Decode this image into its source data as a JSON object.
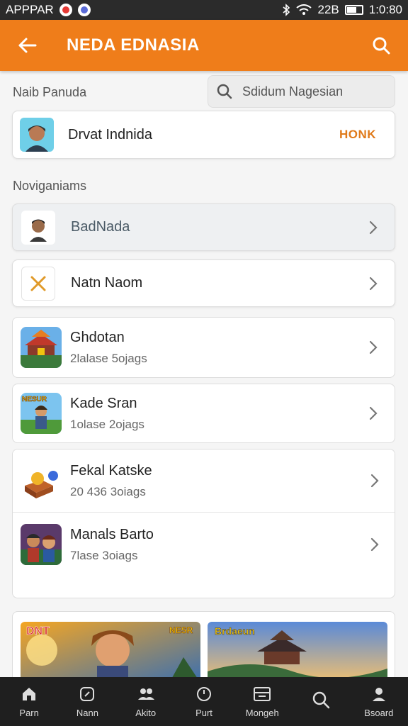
{
  "status_bar": {
    "left_text": "APPPAR",
    "right_text": "22B",
    "time": "1:0:80"
  },
  "app_bar": {
    "title": "NEDA EDNASIA"
  },
  "profile_section": {
    "label": "Naib Panuda"
  },
  "search": {
    "placeholder": "Sdidum Nagesian"
  },
  "profile_card": {
    "name": "Drvat Indnida",
    "action": "HONK"
  },
  "nav_section": {
    "label": "Noviganiams"
  },
  "nav_items": [
    {
      "label": "BadNada",
      "icon": "avatar-icon"
    },
    {
      "label": "Natn Naom",
      "icon": "close-icon"
    }
  ],
  "games": [
    {
      "title": "Ghdotan",
      "subtitle": "2lalase 5ojags",
      "thumb": "temple-game-icon"
    },
    {
      "title": "Kade Sran",
      "subtitle": "1olase 2ojags",
      "thumb": "warrior-game-icon",
      "thumb_text": "NESUR"
    },
    {
      "title": "Fekal Katske",
      "subtitle": "20 436 3oiags",
      "thumb": "treasure-game-icon"
    },
    {
      "title": "Manals Barto",
      "subtitle": "7lase 3oiags",
      "thumb": "heroes-game-icon"
    }
  ],
  "banners": [
    {
      "label": "DNT",
      "badge": "NESR"
    },
    {
      "label": "Brdaeun"
    }
  ],
  "bottom_nav": [
    {
      "label": "Parn",
      "icon": "home-icon"
    },
    {
      "label": "Nann",
      "icon": "compass-icon"
    },
    {
      "label": "Akito",
      "icon": "group-icon"
    },
    {
      "label": "Purt",
      "icon": "clock-icon"
    },
    {
      "label": "Mongeh",
      "icon": "calendar-icon"
    },
    {
      "label": "",
      "icon": "search-icon"
    },
    {
      "label": "Bsoard",
      "icon": "profile-icon"
    }
  ],
  "colors": {
    "accent": "#ef7d1a",
    "accent_text": "#e07a1a",
    "nav_bg": "#1f1f1f"
  }
}
